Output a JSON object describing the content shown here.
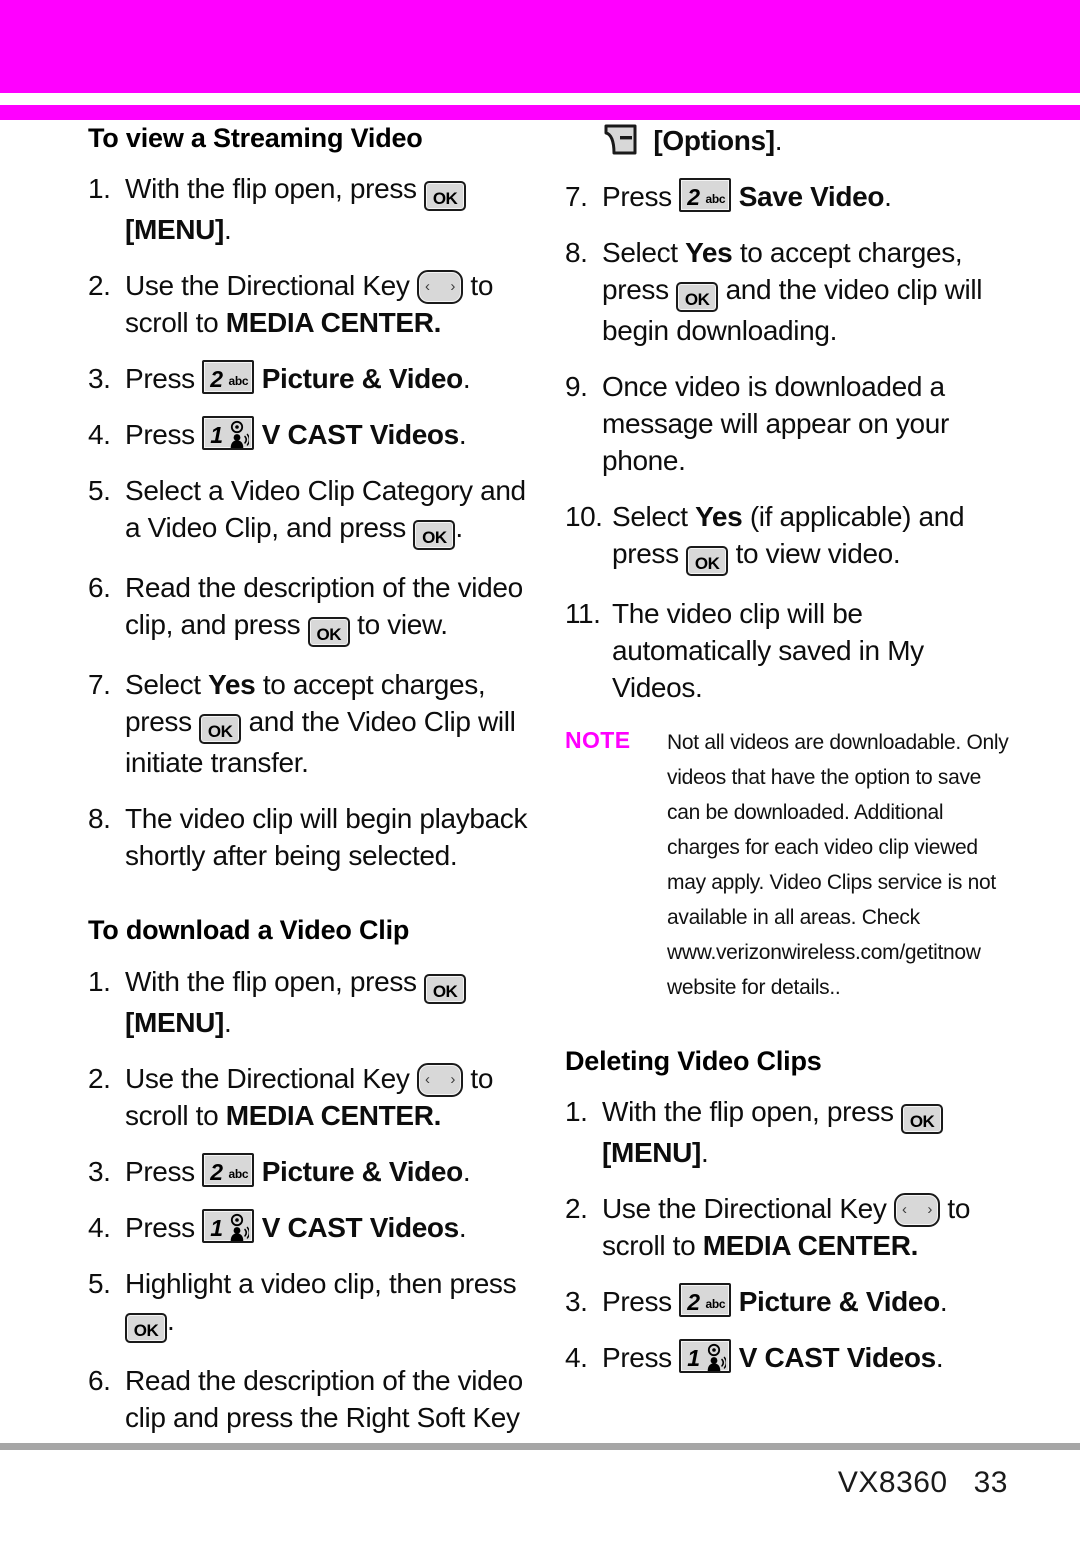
{
  "page": {
    "device_model": "VX8360",
    "page_number": "33",
    "accent_color": "#ff00ff",
    "footer_rule_color": "#a6a6a6"
  },
  "icons": {
    "ok_key": "ok-key-icon",
    "ok_label": "OK",
    "directional_key": "directional-key-icon",
    "key_2_digit": "2",
    "key_2_sub": "abc",
    "key_1_digit": "1",
    "soft_key": "right-soft-key-options-icon"
  },
  "left_column": {
    "heading_1": "To view a Streaming Video",
    "steps_1": [
      {
        "num": "1.",
        "parts": [
          {
            "t": "text",
            "v": "With the flip open, press "
          },
          {
            "t": "key_ok"
          },
          {
            "t": "bold",
            "v": " [MENU]"
          },
          {
            "t": "text",
            "v": "."
          }
        ]
      },
      {
        "num": "2.",
        "parts": [
          {
            "t": "text",
            "v": "Use the Directional Key "
          },
          {
            "t": "key_dir"
          },
          {
            "t": "text",
            "v": " to scroll to "
          },
          {
            "t": "bold",
            "v": "MEDIA CENTER."
          }
        ]
      },
      {
        "num": "3.",
        "parts": [
          {
            "t": "text",
            "v": "Press "
          },
          {
            "t": "key_2"
          },
          {
            "t": "bold",
            "v": " Picture & Video"
          },
          {
            "t": "text",
            "v": "."
          }
        ]
      },
      {
        "num": "4.",
        "parts": [
          {
            "t": "text",
            "v": "Press "
          },
          {
            "t": "key_1"
          },
          {
            "t": "bold",
            "v": " V CAST Videos"
          },
          {
            "t": "text",
            "v": "."
          }
        ]
      },
      {
        "num": "5.",
        "parts": [
          {
            "t": "text",
            "v": "Select a Video Clip Category and a Video Clip, and press "
          },
          {
            "t": "key_ok"
          },
          {
            "t": "text",
            "v": "."
          }
        ]
      },
      {
        "num": "6.",
        "parts": [
          {
            "t": "text",
            "v": "Read the description of the video clip, and press "
          },
          {
            "t": "key_ok"
          },
          {
            "t": "text",
            "v": " to view."
          }
        ]
      },
      {
        "num": "7.",
        "parts": [
          {
            "t": "text",
            "v": "Select "
          },
          {
            "t": "bold",
            "v": "Yes"
          },
          {
            "t": "text",
            "v": " to accept charges, press "
          },
          {
            "t": "key_ok"
          },
          {
            "t": "text",
            "v": " and the Video Clip will initiate transfer."
          }
        ]
      },
      {
        "num": "8.",
        "parts": [
          {
            "t": "text",
            "v": "The video clip will begin playback shortly after being selected."
          }
        ]
      }
    ],
    "heading_2": "To download a Video Clip",
    "steps_2": [
      {
        "num": "1.",
        "parts": [
          {
            "t": "text",
            "v": "With the flip open, press "
          },
          {
            "t": "key_ok"
          },
          {
            "t": "bold",
            "v": " [MENU]"
          },
          {
            "t": "text",
            "v": "."
          }
        ]
      },
      {
        "num": "2.",
        "parts": [
          {
            "t": "text",
            "v": "Use the Directional Key "
          },
          {
            "t": "key_dir"
          },
          {
            "t": "text",
            "v": " to scroll to "
          },
          {
            "t": "bold",
            "v": "MEDIA CENTER."
          }
        ]
      },
      {
        "num": "3.",
        "parts": [
          {
            "t": "text",
            "v": "Press "
          },
          {
            "t": "key_2"
          },
          {
            "t": "bold",
            "v": " Picture & Video"
          },
          {
            "t": "text",
            "v": "."
          }
        ]
      },
      {
        "num": "4.",
        "parts": [
          {
            "t": "text",
            "v": "Press "
          },
          {
            "t": "key_1"
          },
          {
            "t": "bold",
            "v": " V CAST Videos"
          },
          {
            "t": "text",
            "v": "."
          }
        ]
      },
      {
        "num": "5.",
        "parts": [
          {
            "t": "text",
            "v": "Highlight a video clip, then press "
          },
          {
            "t": "key_ok"
          },
          {
            "t": "text",
            "v": "."
          }
        ]
      },
      {
        "num": "6.",
        "parts": [
          {
            "t": "text",
            "v": "Read the description of the video clip and press the Right Soft Key"
          }
        ]
      }
    ]
  },
  "right_column": {
    "continuation": [
      {
        "t": "key_soft"
      },
      {
        "t": "bold",
        "v": " [Options]"
      },
      {
        "t": "text",
        "v": "."
      }
    ],
    "steps_1": [
      {
        "num": "7.",
        "parts": [
          {
            "t": "text",
            "v": "Press "
          },
          {
            "t": "key_2"
          },
          {
            "t": "bold",
            "v": " Save Video"
          },
          {
            "t": "text",
            "v": "."
          }
        ]
      },
      {
        "num": "8.",
        "parts": [
          {
            "t": "text",
            "v": "Select "
          },
          {
            "t": "bold",
            "v": "Yes"
          },
          {
            "t": "text",
            "v": " to accept charges, press "
          },
          {
            "t": "key_ok"
          },
          {
            "t": "text",
            "v": " and the video clip will begin downloading."
          }
        ]
      },
      {
        "num": "9.",
        "parts": [
          {
            "t": "text",
            "v": "Once video is downloaded a message will appear on your phone."
          }
        ]
      },
      {
        "num": "10.",
        "parts": [
          {
            "t": "text",
            "v": "Select "
          },
          {
            "t": "bold",
            "v": "Yes"
          },
          {
            "t": "text",
            "v": " (if applicable) and press "
          },
          {
            "t": "key_ok"
          },
          {
            "t": "text",
            "v": " to view video."
          }
        ]
      },
      {
        "num": "11.",
        "parts": [
          {
            "t": "text",
            "v": "The video clip will be automatically saved in My Videos."
          }
        ]
      }
    ],
    "note": {
      "label": "NOTE",
      "text": "Not all videos are downloadable. Only videos that have the option to save can be downloaded. Additional charges for each video clip viewed may apply. Video Clips service is not available in all areas. Check www.verizonwireless.com/getitnow website for details.."
    },
    "heading_1": "Deleting Video Clips",
    "steps_2": [
      {
        "num": "1.",
        "parts": [
          {
            "t": "text",
            "v": "With the flip open, press "
          },
          {
            "t": "key_ok"
          },
          {
            "t": "bold",
            "v": " [MENU]"
          },
          {
            "t": "text",
            "v": "."
          }
        ]
      },
      {
        "num": "2.",
        "parts": [
          {
            "t": "text",
            "v": "Use the Directional Key "
          },
          {
            "t": "key_dir"
          },
          {
            "t": "text",
            "v": " to scroll to "
          },
          {
            "t": "bold",
            "v": "MEDIA CENTER."
          }
        ]
      },
      {
        "num": "3.",
        "parts": [
          {
            "t": "text",
            "v": "Press "
          },
          {
            "t": "key_2"
          },
          {
            "t": "bold",
            "v": " Picture & Video"
          },
          {
            "t": "text",
            "v": "."
          }
        ]
      },
      {
        "num": "4.",
        "parts": [
          {
            "t": "text",
            "v": "Press "
          },
          {
            "t": "key_1"
          },
          {
            "t": "bold",
            "v": " V CAST Videos"
          },
          {
            "t": "text",
            "v": "."
          }
        ]
      }
    ]
  }
}
